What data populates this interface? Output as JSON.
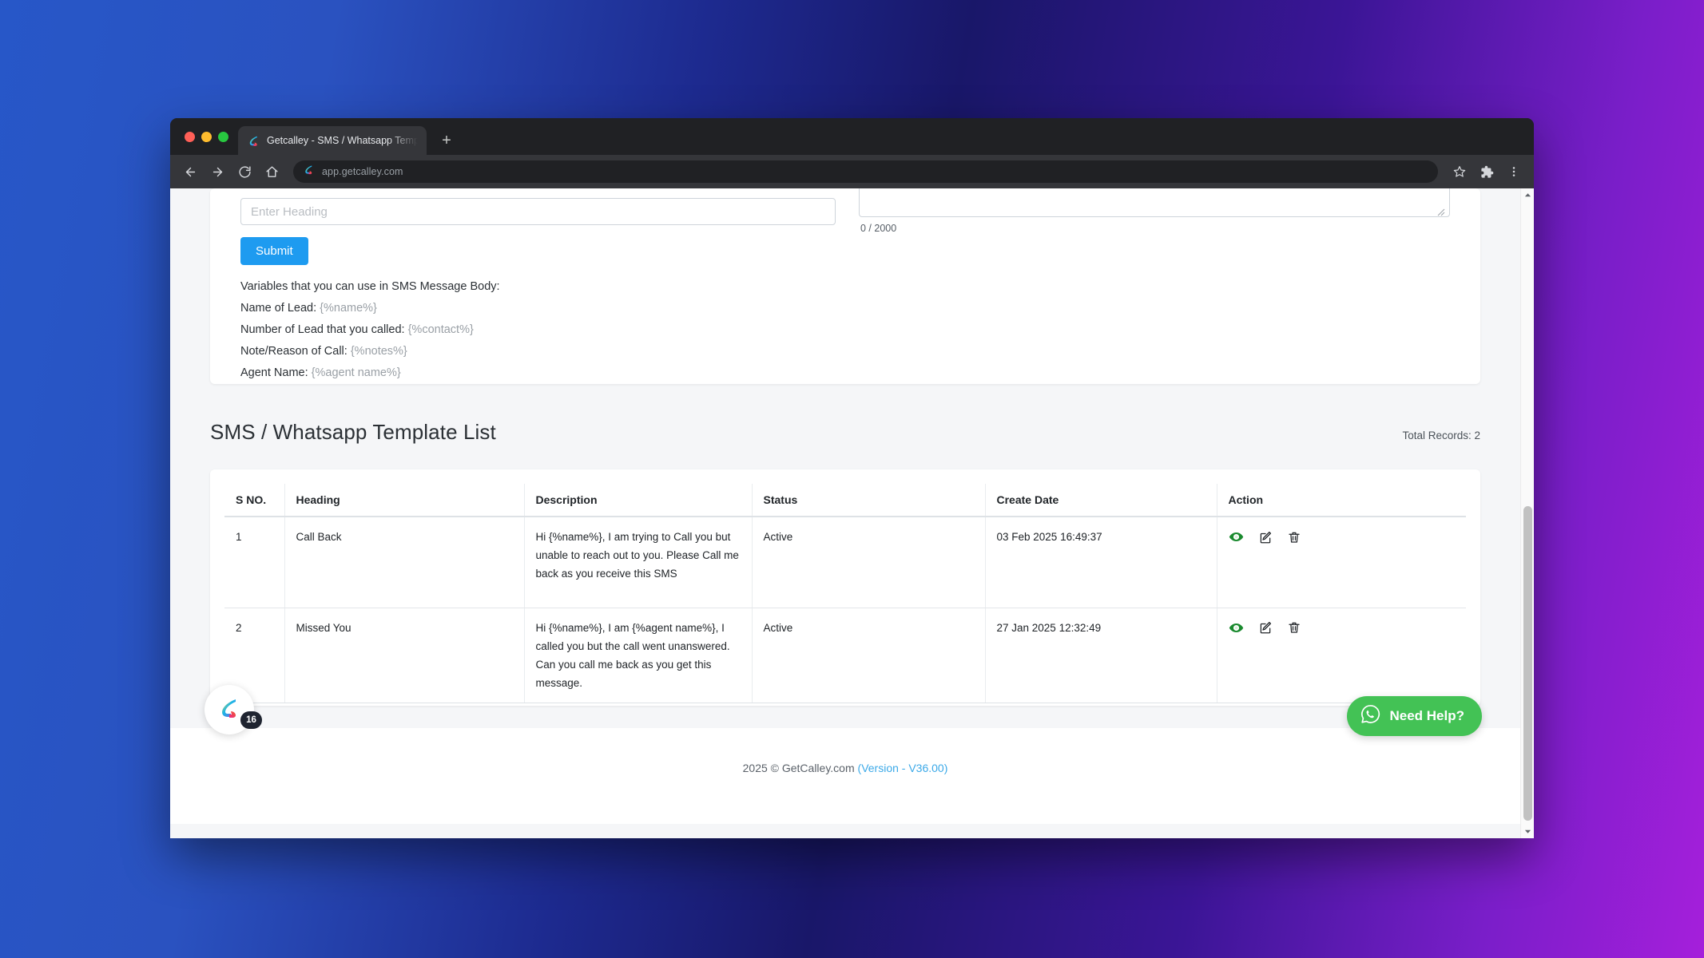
{
  "browser": {
    "tab": {
      "title": "Getcalley - SMS / Whatsapp Temp",
      "favicon": "calley-logo-icon"
    },
    "new_tab_label": "+",
    "nav": {
      "back": "back-arrow-icon",
      "forward": "forward-arrow-icon",
      "reload": "reload-icon",
      "home": "home-icon"
    },
    "omnibox": {
      "url": "app.getcalley.com",
      "favicon": "calley-logo-icon"
    },
    "right_icons": [
      "bookmark-star-icon",
      "extensions-puzzle-icon",
      "browser-menu-icon"
    ]
  },
  "form": {
    "heading_input": {
      "value": "",
      "placeholder": "Enter Heading"
    },
    "message_textarea": {
      "value": "",
      "placeholder": ""
    },
    "counter": "0 / 2000",
    "submit_label": "Submit",
    "variables_intro": "Variables that you can use in SMS Message Body:",
    "variables": [
      {
        "label": "Name of Lead:",
        "token": "{%name%}"
      },
      {
        "label": "Number of Lead that you called:",
        "token": "{%contact%}"
      },
      {
        "label": "Note/Reason of Call:",
        "token": "{%notes%}"
      },
      {
        "label": "Agent Name:",
        "token": "{%agent name%}"
      }
    ]
  },
  "list": {
    "title": "SMS / Whatsapp Template List",
    "total_records": "Total Records: 2",
    "columns": [
      "S NO.",
      "Heading",
      "Description",
      "Status",
      "Create Date",
      "Action"
    ],
    "rows": [
      {
        "sno": "1",
        "heading": "Call Back",
        "description": "Hi {%name%}, I am trying to Call you but unable to reach out to you. Please Call me back as you receive this SMS",
        "status": "Active",
        "create_date": "03 Feb 2025 16:49:37",
        "actions": [
          "view-eye-icon",
          "edit-icon",
          "delete-trash-icon"
        ]
      },
      {
        "sno": "2",
        "heading": "Missed You",
        "description": "Hi {%name%}, I am {%agent name%}, I called you but the call went unanswered. Can you call me back as you get this message.",
        "status": "Active",
        "create_date": "27 Jan 2025 12:32:49",
        "actions": [
          "view-eye-icon",
          "edit-icon",
          "delete-trash-icon"
        ]
      }
    ]
  },
  "footer": {
    "copyright": "2025 © GetCalley.com ",
    "version": "(Version - V36.00)"
  },
  "widgets": {
    "chat_badge_count": "16",
    "need_help_label": "Need Help?",
    "whatsapp_icon": "whatsapp-icon"
  },
  "colors": {
    "accent_blue": "#1e9bf0",
    "whatsapp_green": "#43c255",
    "view_icon_green": "#1a8a2e",
    "version_link": "#3ba9e8"
  }
}
